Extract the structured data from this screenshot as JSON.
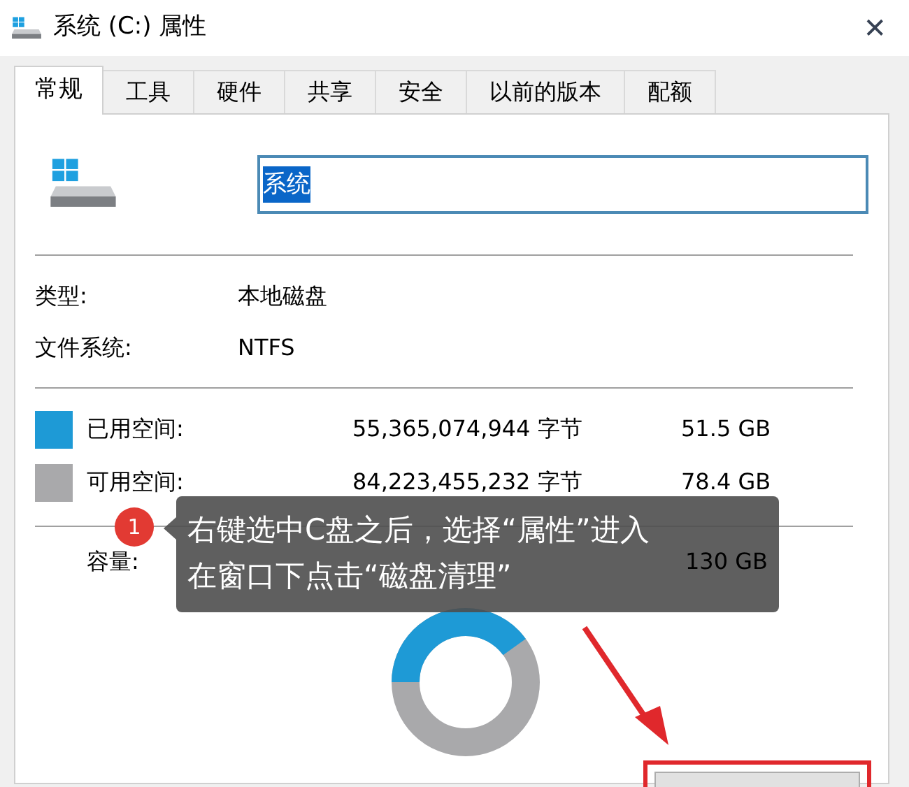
{
  "window": {
    "title": "系统 (C:) 属性",
    "close": "✕"
  },
  "tabs": [
    {
      "label": "常规",
      "selected": true
    },
    {
      "label": "工具",
      "selected": false
    },
    {
      "label": "硬件",
      "selected": false
    },
    {
      "label": "共享",
      "selected": false
    },
    {
      "label": "安全",
      "selected": false
    },
    {
      "label": "以前的版本",
      "selected": false
    },
    {
      "label": "配额",
      "selected": false
    }
  ],
  "name_field": {
    "value": "系统"
  },
  "info": [
    {
      "label": "类型:",
      "value": "本地磁盘"
    },
    {
      "label": "文件系统:",
      "value": "NTFS"
    }
  ],
  "space": [
    {
      "label": "已用空间:",
      "bytes": "55,365,074,944 字节",
      "size": "51.5 GB",
      "color": "#1e9ad6"
    },
    {
      "label": "可用空间:",
      "bytes": "84,223,455,232 字节",
      "size": "78.4 GB",
      "color": "#a9a9ab"
    }
  ],
  "capacity": {
    "label": "容量:",
    "size": "130 GB"
  },
  "callout": {
    "step": "1",
    "lines": [
      "右键选中C盘之后，选择“属性”进入",
      "在窗口下点击“磁盘清理”"
    ]
  }
}
